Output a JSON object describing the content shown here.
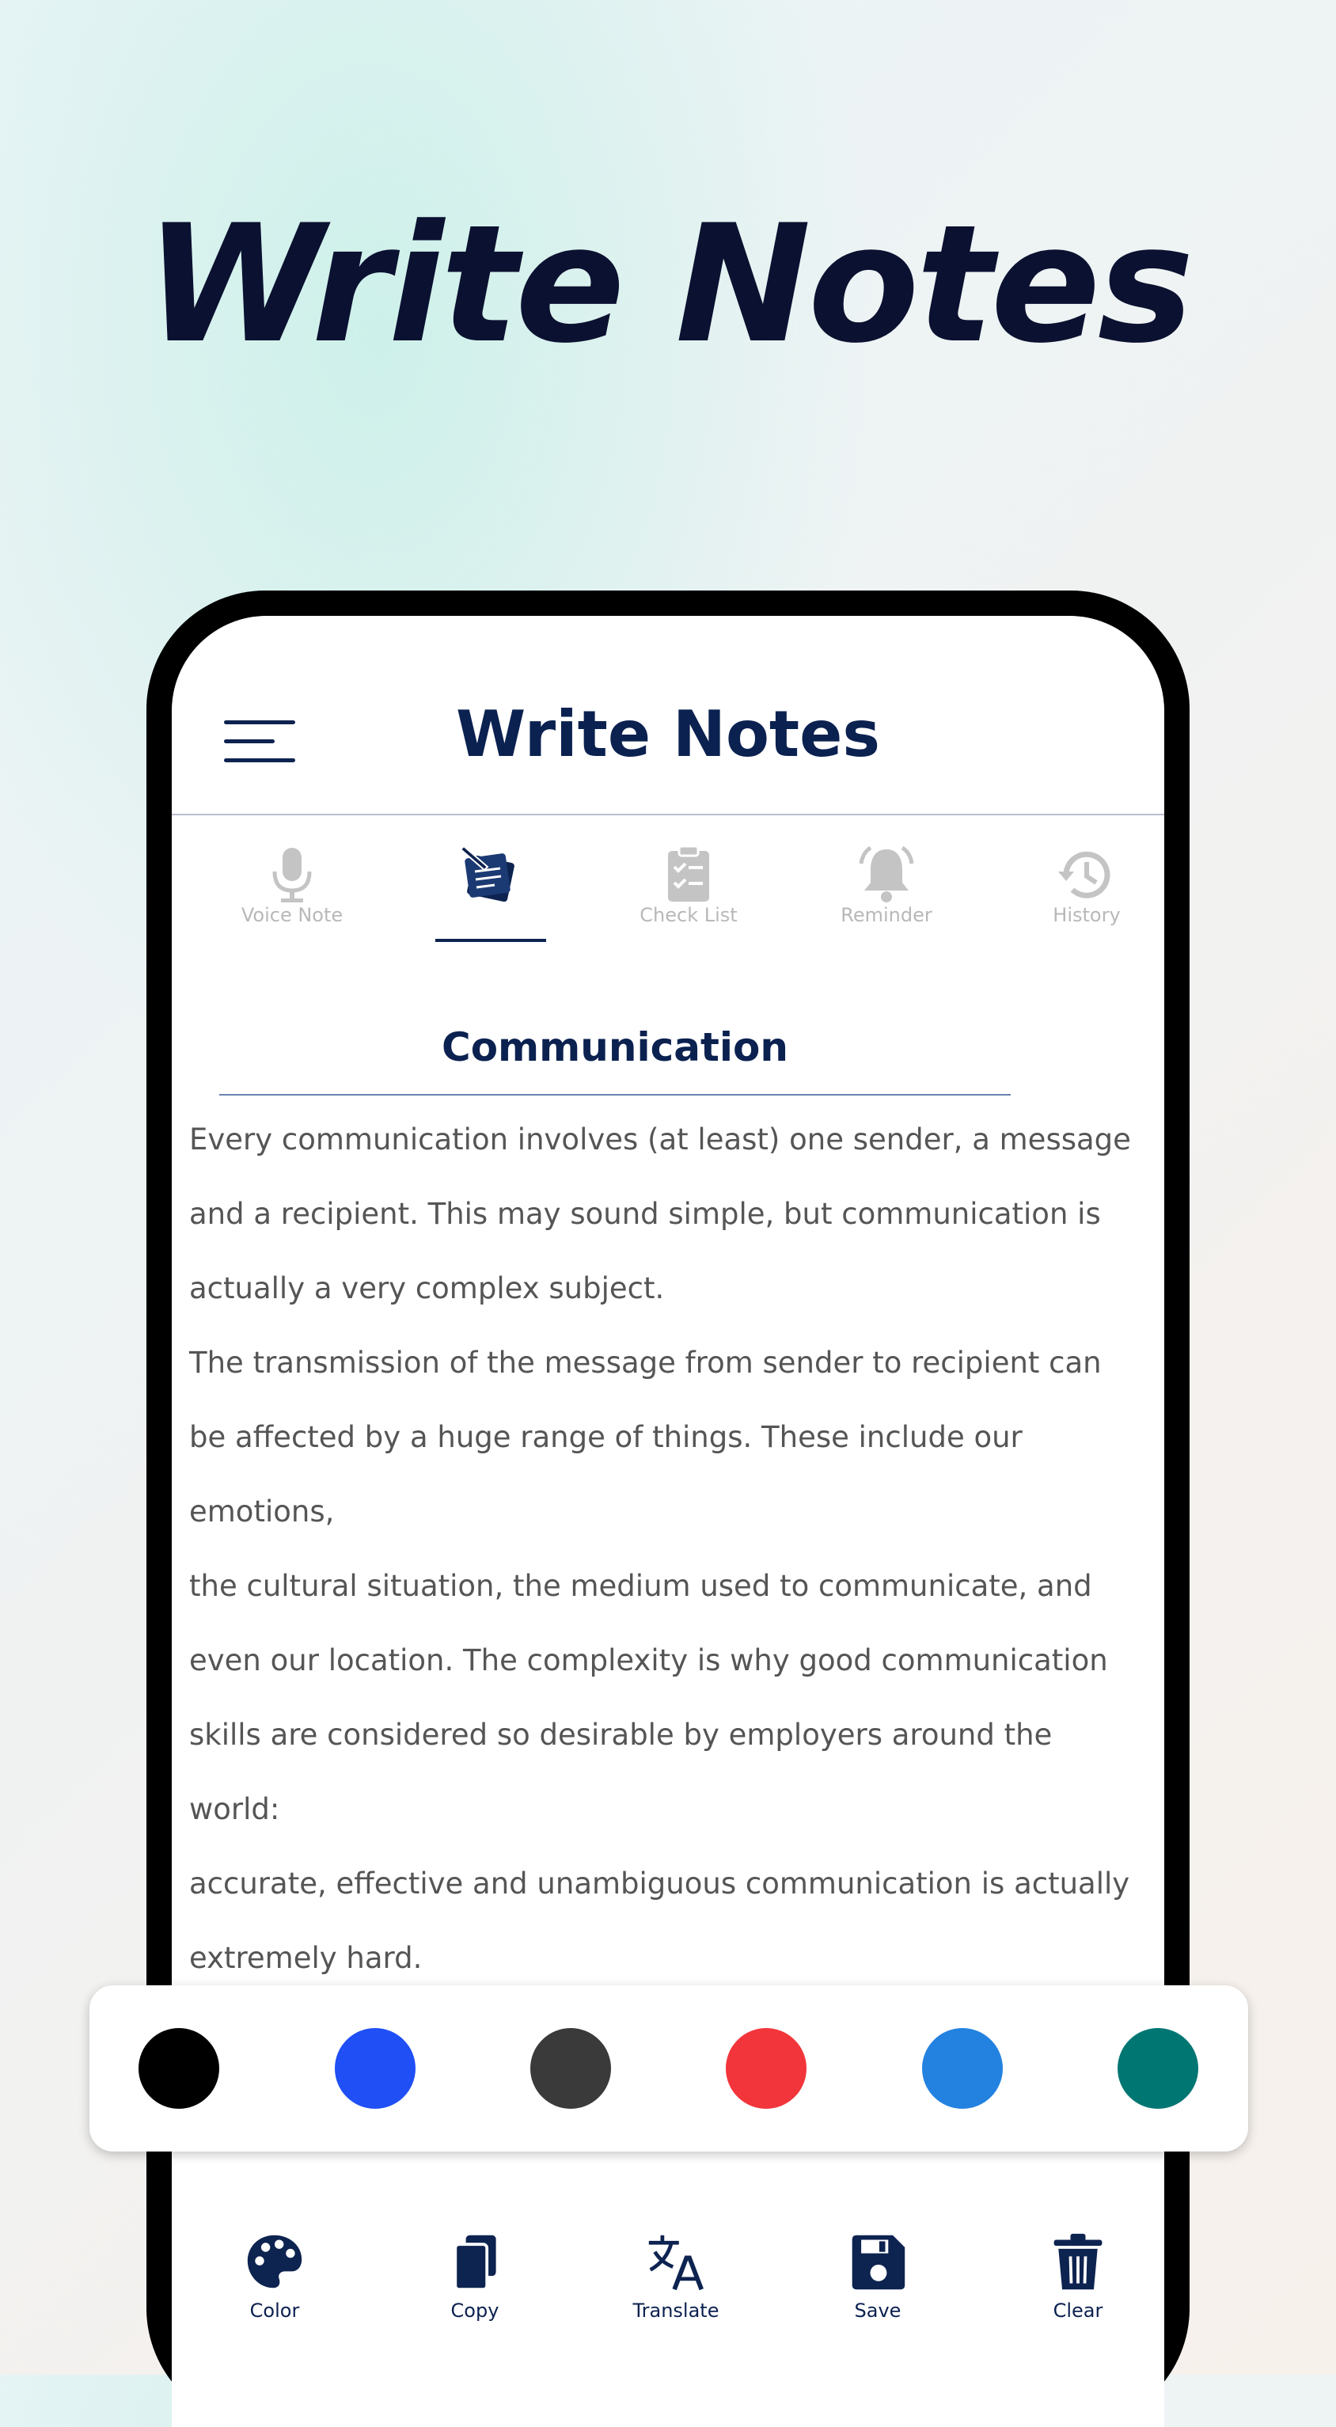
{
  "hero": {
    "title": "Write Notes"
  },
  "app": {
    "title": "Write Notes",
    "tabs": [
      {
        "label": "Voice Note",
        "icon": "microphone-icon",
        "active": false
      },
      {
        "label": "",
        "icon": "write-note-icon",
        "active": true
      },
      {
        "label": "Check List",
        "icon": "clipboard-checklist-icon",
        "active": false
      },
      {
        "label": "Reminder",
        "icon": "bell-icon",
        "active": false
      },
      {
        "label": "History",
        "icon": "history-clock-icon",
        "active": false
      }
    ]
  },
  "note": {
    "title": "Communication",
    "lines": [
      "Every communication involves (at least) one sender, a message",
      "and a recipient. This may sound simple, but communication is",
      "actually a very complex subject.",
      "The transmission of the message from sender to recipient can",
      "be affected by a huge range of things. These include our emotions,",
      "the cultural situation, the medium used to communicate, and",
      "even our location. The complexity is why good communication",
      "skills are considered so desirable by employers around the world:",
      "accurate, effective and unambiguous communication is actually",
      "extremely hard."
    ]
  },
  "palette": {
    "colors": [
      "#000000",
      "#1f4ff5",
      "#3a3a3a",
      "#f2353b",
      "#2382e0",
      "#007673"
    ]
  },
  "toolbar": {
    "items": [
      {
        "label": "Color",
        "icon": "palette-icon"
      },
      {
        "label": "Copy",
        "icon": "copy-icon"
      },
      {
        "label": "Translate",
        "icon": "translate-icon"
      },
      {
        "label": "Save",
        "icon": "save-icon"
      },
      {
        "label": "Clear",
        "icon": "trash-icon"
      }
    ]
  },
  "colors": {
    "primary": "#0b2150",
    "inactive": "#b8b8b8",
    "body_text": "#555555"
  }
}
